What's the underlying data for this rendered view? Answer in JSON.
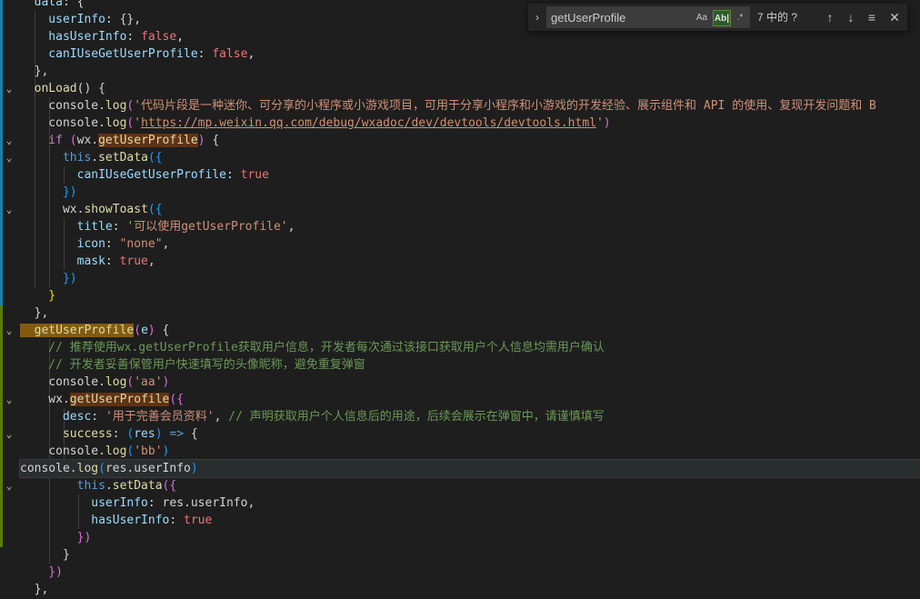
{
  "find": {
    "query": "getUserProfile",
    "match_case_label": "Aa",
    "whole_word_label": "Ab|",
    "regex_label": ".*",
    "count": "7 中的 ?",
    "toggle_icon": "chevron-right-icon",
    "prev_icon": "arrow-up-icon",
    "next_icon": "arrow-down-icon",
    "selection_icon": "lines-icon",
    "close_icon": "close-icon"
  },
  "lines": [
    [
      [
        "t-prop",
        "  data"
      ],
      [
        "t-plain",
        ": {"
      ]
    ],
    [
      [
        "t-prop",
        "    userInfo"
      ],
      [
        "t-plain",
        ": {},"
      ]
    ],
    [
      [
        "t-prop",
        "    hasUserInfo"
      ],
      [
        "t-plain",
        ": "
      ],
      [
        "t-bool",
        "false"
      ],
      [
        "t-plain",
        ","
      ]
    ],
    [
      [
        "t-prop",
        "    canIUseGetUserProfile"
      ],
      [
        "t-plain",
        ": "
      ],
      [
        "t-bool",
        "false"
      ],
      [
        "t-plain",
        ","
      ]
    ],
    [
      [
        "t-plain",
        "  },"
      ]
    ],
    [
      [
        "t-fn",
        "  onLoad"
      ],
      [
        "t-plain",
        "() {"
      ]
    ],
    [
      [
        "t-plain",
        "    console."
      ],
      [
        "t-fn",
        "log"
      ],
      [
        "t-bracket2",
        "("
      ],
      [
        "t-str",
        "'代码片段是一种迷你、可分享的小程序或小游戏项目，可用于分享小程序和小游戏的开发经验、展示组件和 API 的使用、复现开发问题和 B"
      ]
    ],
    [
      [
        "t-plain",
        "    console."
      ],
      [
        "t-fn",
        "log"
      ],
      [
        "t-bracket2",
        "("
      ],
      [
        "t-str",
        "'"
      ],
      [
        "t-link",
        "https://mp.weixin.qq.com/debug/wxadoc/dev/devtools/devtools.html"
      ],
      [
        "t-str",
        "'"
      ],
      [
        "t-bracket2",
        ")"
      ]
    ],
    [
      [
        "t-kw",
        "    if "
      ],
      [
        "t-bracket2",
        "("
      ],
      [
        "t-plain",
        "wx."
      ],
      [
        "t-match",
        "getUserProfile"
      ],
      [
        "t-bracket2",
        ")"
      ],
      [
        "t-plain",
        " {"
      ]
    ],
    [
      [
        "t-this",
        "      this"
      ],
      [
        "t-plain",
        "."
      ],
      [
        "t-fn",
        "setData"
      ],
      [
        "t-bracket3",
        "({"
      ]
    ],
    [
      [
        "t-prop",
        "        canIUseGetUserProfile"
      ],
      [
        "t-plain",
        ": "
      ],
      [
        "t-bool",
        "true"
      ]
    ],
    [
      [
        "t-bracket3",
        "      })"
      ]
    ],
    [
      [
        "t-plain",
        "      wx."
      ],
      [
        "t-fn",
        "showToast"
      ],
      [
        "t-bracket3",
        "({"
      ]
    ],
    [
      [
        "t-prop",
        "        title"
      ],
      [
        "t-plain",
        ": "
      ],
      [
        "t-str",
        "'可以使用getUserProfile'"
      ],
      [
        "t-plain",
        ","
      ]
    ],
    [
      [
        "t-prop",
        "        icon"
      ],
      [
        "t-plain",
        ": "
      ],
      [
        "t-str",
        "\"none\""
      ],
      [
        "t-plain",
        ","
      ]
    ],
    [
      [
        "t-prop",
        "        mask"
      ],
      [
        "t-plain",
        ": "
      ],
      [
        "t-bool",
        "true"
      ],
      [
        "t-plain",
        ","
      ]
    ],
    [
      [
        "t-bracket3",
        "      })"
      ]
    ],
    [
      [
        "t-bracket1",
        "    }"
      ]
    ],
    [
      [
        "t-plain",
        "  },"
      ]
    ],
    [
      [
        "t-match-active",
        "  getUserProfile"
      ],
      [
        "t-bracket2",
        "("
      ],
      [
        "t-param",
        "e"
      ],
      [
        "t-bracket2",
        ")"
      ],
      [
        "t-plain",
        " {"
      ]
    ],
    [
      [
        "t-com",
        "    // 推荐使用wx.getUserProfile获取用户信息，开发者每次通过该接口获取用户个人信息均需用户确认"
      ]
    ],
    [
      [
        "t-com",
        "    // 开发者妥善保管用户快速填写的头像昵称，避免重复弹窗"
      ]
    ],
    [
      [
        "t-plain",
        "    console."
      ],
      [
        "t-fn",
        "log"
      ],
      [
        "t-bracket2",
        "("
      ],
      [
        "t-str",
        "'aa'"
      ],
      [
        "t-bracket2",
        ")"
      ]
    ],
    [
      [
        "t-plain",
        "    wx."
      ],
      [
        "t-match",
        "getUserProfile"
      ],
      [
        "t-bracket2",
        "({"
      ]
    ],
    [
      [
        "t-prop",
        "      desc"
      ],
      [
        "t-plain",
        ": "
      ],
      [
        "t-str",
        "'用于完善会员资料'"
      ],
      [
        "t-plain",
        ", "
      ],
      [
        "t-com",
        "// 声明获取用户个人信息后的用途，后续会展示在弹窗中，请谨慎填写"
      ]
    ],
    [
      [
        "t-fn",
        "      success"
      ],
      [
        "t-plain",
        ": "
      ],
      [
        "t-bracket3",
        "("
      ],
      [
        "t-param",
        "res"
      ],
      [
        "t-bracket3",
        ")"
      ],
      [
        "t-this",
        " =>"
      ],
      [
        "t-plain",
        " {"
      ]
    ],
    [
      [
        "t-plain",
        "    console."
      ],
      [
        "t-fn",
        "log"
      ],
      [
        "t-bracket3",
        "("
      ],
      [
        "t-str",
        "'bb'"
      ],
      [
        "t-bracket3",
        ")"
      ]
    ],
    [
      [
        "t-plain",
        "console."
      ],
      [
        "t-fn",
        "log"
      ],
      [
        "t-bracket3",
        "("
      ],
      [
        "t-plain",
        "res.userInfo"
      ],
      [
        "t-bracket3",
        ")"
      ]
    ],
    [
      [
        "t-this",
        "        this"
      ],
      [
        "t-plain",
        "."
      ],
      [
        "t-fn",
        "setData"
      ],
      [
        "t-bracket2",
        "({"
      ]
    ],
    [
      [
        "t-prop",
        "          userInfo"
      ],
      [
        "t-plain",
        ": res.userInfo,"
      ]
    ],
    [
      [
        "t-prop",
        "          hasUserInfo"
      ],
      [
        "t-plain",
        ": "
      ],
      [
        "t-bool",
        "true"
      ]
    ],
    [
      [
        "t-bracket2",
        "        })"
      ]
    ],
    [
      [
        "t-plain",
        "      }"
      ]
    ],
    [
      [
        "t-bracket2",
        "    })"
      ]
    ],
    [
      [
        "t-plain",
        "  },"
      ]
    ]
  ]
}
